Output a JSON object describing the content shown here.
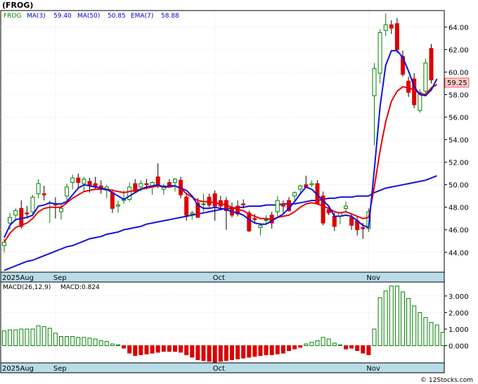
{
  "title": "(FROG)",
  "legend": [
    {
      "text": "FROG",
      "color": "#008000"
    },
    {
      "text": "MA(3)",
      "color": "#0000cc"
    },
    {
      "text": "59.40",
      "color": "#0000cc"
    },
    {
      "text": "MA(50)",
      "color": "#0000cc"
    },
    {
      "text": "50.85",
      "color": "#0000cc"
    },
    {
      "text": "EMA(7)",
      "color": "#0000cc"
    },
    {
      "text": "58.88",
      "color": "#0000cc"
    }
  ],
  "last_price": "59.25",
  "macd_legend": {
    "label": "MACD(26,12,9)",
    "value_label": "MACD:0.824"
  },
  "watermark": "© 12Stocks.com",
  "colors": {
    "up": "#008000",
    "down": "#dd0000",
    "ma": "#1111dd",
    "ema": "#ee0000",
    "axis_band": "#b8dde8",
    "grid": "#cccccc"
  },
  "chart_data": [
    {
      "type": "candlestick",
      "title": "(FROG)",
      "x_labels": [
        "2025Aug",
        "Sep",
        "Oct",
        "Nov"
      ],
      "x_label_index": [
        0,
        9,
        37,
        64
      ],
      "y_ticks": [
        "44.00",
        "46.00",
        "48.00",
        "50.00",
        "52.00",
        "54.00",
        "56.00",
        "58.00",
        "60.00",
        "62.00",
        "64.00"
      ],
      "ylim": [
        42.3,
        65.4
      ],
      "candles": [
        {
          "o": 44.6,
          "h": 45.2,
          "l": 44.0,
          "c": 44.9
        },
        {
          "o": 46.6,
          "h": 47.5,
          "l": 46.0,
          "c": 47.1
        },
        {
          "o": 47.3,
          "h": 47.9,
          "l": 46.8,
          "c": 47.7
        },
        {
          "o": 47.9,
          "h": 48.6,
          "l": 46.1,
          "c": 46.3
        },
        {
          "o": 47.5,
          "h": 48.1,
          "l": 47.0,
          "c": 47.4
        },
        {
          "o": 47.6,
          "h": 49.1,
          "l": 47.4,
          "c": 48.9
        },
        {
          "o": 49.2,
          "h": 50.5,
          "l": 48.8,
          "c": 50.1
        },
        {
          "o": 49.2,
          "h": 49.9,
          "l": 48.6,
          "c": 49.1
        },
        {
          "o": 48.4,
          "h": 48.6,
          "l": 46.6,
          "c": 48.4
        },
        {
          "o": 48.3,
          "h": 48.9,
          "l": 47.0,
          "c": 48.2
        },
        {
          "o": 47.6,
          "h": 48.3,
          "l": 46.9,
          "c": 47.9
        },
        {
          "o": 49.0,
          "h": 50.1,
          "l": 48.5,
          "c": 49.8
        },
        {
          "o": 50.2,
          "h": 50.9,
          "l": 49.6,
          "c": 50.6
        },
        {
          "o": 50.6,
          "h": 51.0,
          "l": 49.7,
          "c": 50.2
        },
        {
          "o": 50.1,
          "h": 50.7,
          "l": 49.4,
          "c": 50.5
        },
        {
          "o": 50.3,
          "h": 50.6,
          "l": 49.3,
          "c": 49.9
        },
        {
          "o": 50.1,
          "h": 50.7,
          "l": 49.6,
          "c": 49.8
        },
        {
          "o": 49.9,
          "h": 50.4,
          "l": 49.2,
          "c": 49.6
        },
        {
          "o": 49.5,
          "h": 50.0,
          "l": 48.8,
          "c": 49.8
        },
        {
          "o": 49.3,
          "h": 49.6,
          "l": 47.5,
          "c": 47.9
        },
        {
          "o": 48.1,
          "h": 48.6,
          "l": 47.5,
          "c": 48.2
        },
        {
          "o": 48.6,
          "h": 49.5,
          "l": 48.3,
          "c": 48.7
        },
        {
          "o": 48.7,
          "h": 50.2,
          "l": 48.5,
          "c": 49.8
        },
        {
          "o": 50.1,
          "h": 50.5,
          "l": 49.3,
          "c": 49.4
        },
        {
          "o": 49.8,
          "h": 50.4,
          "l": 49.4,
          "c": 50.1
        },
        {
          "o": 50.1,
          "h": 50.5,
          "l": 49.6,
          "c": 50.0
        },
        {
          "o": 49.9,
          "h": 50.3,
          "l": 49.1,
          "c": 50.2
        },
        {
          "o": 50.7,
          "h": 51.9,
          "l": 49.7,
          "c": 49.9
        },
        {
          "o": 49.6,
          "h": 50.1,
          "l": 49.1,
          "c": 49.9
        },
        {
          "o": 50.2,
          "h": 50.5,
          "l": 49.8,
          "c": 49.9
        },
        {
          "o": 50.2,
          "h": 50.6,
          "l": 49.4,
          "c": 50.5
        },
        {
          "o": 50.4,
          "h": 50.7,
          "l": 48.8,
          "c": 49.1
        },
        {
          "o": 48.9,
          "h": 49.2,
          "l": 46.8,
          "c": 47.3
        },
        {
          "o": 47.4,
          "h": 47.7,
          "l": 46.9,
          "c": 47.5
        },
        {
          "o": 48.4,
          "h": 48.8,
          "l": 47.1,
          "c": 47.1
        },
        {
          "o": 48.3,
          "h": 49.2,
          "l": 47.6,
          "c": 48.3
        },
        {
          "o": 48.9,
          "h": 49.2,
          "l": 48.0,
          "c": 48.2
        },
        {
          "o": 49.2,
          "h": 49.5,
          "l": 46.8,
          "c": 48.1
        },
        {
          "o": 48.6,
          "h": 49.0,
          "l": 47.8,
          "c": 48.1
        },
        {
          "o": 48.6,
          "h": 48.9,
          "l": 46.0,
          "c": 47.7
        },
        {
          "o": 48.0,
          "h": 48.4,
          "l": 47.1,
          "c": 47.3
        },
        {
          "o": 48.1,
          "h": 48.6,
          "l": 47.2,
          "c": 47.4
        },
        {
          "o": 48.3,
          "h": 48.7,
          "l": 47.9,
          "c": 48.2
        },
        {
          "o": 47.5,
          "h": 47.7,
          "l": 45.8,
          "c": 45.9
        },
        {
          "o": 47.0,
          "h": 47.4,
          "l": 46.6,
          "c": 46.9
        },
        {
          "o": 46.2,
          "h": 46.6,
          "l": 45.5,
          "c": 46.4
        },
        {
          "o": 46.9,
          "h": 47.3,
          "l": 46.5,
          "c": 46.9
        },
        {
          "o": 47.3,
          "h": 47.6,
          "l": 46.1,
          "c": 46.6
        },
        {
          "o": 47.6,
          "h": 49.0,
          "l": 47.2,
          "c": 48.6
        },
        {
          "o": 48.3,
          "h": 48.6,
          "l": 47.5,
          "c": 48.1
        },
        {
          "o": 48.6,
          "h": 48.9,
          "l": 47.6,
          "c": 47.7
        },
        {
          "o": 49.0,
          "h": 49.4,
          "l": 48.6,
          "c": 49.3
        },
        {
          "o": 49.6,
          "h": 50.0,
          "l": 49.3,
          "c": 49.9
        },
        {
          "o": 50.0,
          "h": 50.8,
          "l": 49.8,
          "c": 49.8
        },
        {
          "o": 50.0,
          "h": 50.4,
          "l": 49.8,
          "c": 50.1
        },
        {
          "o": 50.1,
          "h": 50.4,
          "l": 48.3,
          "c": 48.3
        },
        {
          "o": 49.0,
          "h": 49.4,
          "l": 46.4,
          "c": 46.6
        },
        {
          "o": 47.8,
          "h": 48.1,
          "l": 47.3,
          "c": 47.5
        },
        {
          "o": 47.2,
          "h": 47.5,
          "l": 45.9,
          "c": 46.3
        },
        {
          "o": 47.2,
          "h": 47.6,
          "l": 46.5,
          "c": 47.5
        },
        {
          "o": 47.9,
          "h": 48.5,
          "l": 47.6,
          "c": 48.1
        },
        {
          "o": 47.1,
          "h": 47.4,
          "l": 46.0,
          "c": 46.4
        },
        {
          "o": 46.8,
          "h": 47.2,
          "l": 45.5,
          "c": 46.0
        },
        {
          "o": 46.2,
          "h": 46.6,
          "l": 45.2,
          "c": 46.1
        },
        {
          "o": 46.1,
          "h": 47.9,
          "l": 45.8,
          "c": 47.6
        },
        {
          "o": 57.9,
          "h": 60.8,
          "l": 53.5,
          "c": 60.3
        },
        {
          "o": 59.9,
          "h": 63.8,
          "l": 59.0,
          "c": 63.5
        },
        {
          "o": 63.7,
          "h": 65.2,
          "l": 63.2,
          "c": 64.2
        },
        {
          "o": 64.2,
          "h": 64.6,
          "l": 63.4,
          "c": 63.9
        },
        {
          "o": 64.3,
          "h": 64.8,
          "l": 61.7,
          "c": 62.0
        },
        {
          "o": 61.4,
          "h": 61.9,
          "l": 59.6,
          "c": 59.8
        },
        {
          "o": 59.2,
          "h": 59.6,
          "l": 57.8,
          "c": 58.2
        },
        {
          "o": 59.4,
          "h": 59.9,
          "l": 56.8,
          "c": 57.1
        },
        {
          "o": 56.6,
          "h": 58.5,
          "l": 56.4,
          "c": 58.2
        },
        {
          "o": 58.3,
          "h": 61.2,
          "l": 58.0,
          "c": 60.8
        },
        {
          "o": 62.1,
          "h": 62.5,
          "l": 59.0,
          "c": 59.3
        }
      ],
      "ma3": [
        45.3,
        46.4,
        46.9,
        47.0,
        47.1,
        47.3,
        48.1,
        48.2,
        48.4,
        48.3,
        48.3,
        48.5,
        49.1,
        49.7,
        50.0,
        49.9,
        49.8,
        49.7,
        49.6,
        49.3,
        49.0,
        48.7,
        49.0,
        49.3,
        49.6,
        49.8,
        49.9,
        50.0,
        49.8,
        49.9,
        49.9,
        49.7,
        49.5,
        49.0,
        48.2,
        47.9,
        47.9,
        48.0,
        47.9,
        47.8,
        47.6,
        47.5,
        47.3,
        46.9,
        46.6,
        46.5,
        46.5,
        46.8,
        47.1,
        47.4,
        47.9,
        48.5,
        49.2,
        49.8,
        49.6,
        49.1,
        48.6,
        48.1,
        47.2,
        47.2,
        47.3,
        47.2,
        46.8,
        46.4,
        46.2,
        51.3,
        56.9,
        60.6,
        61.9,
        61.9,
        61.3,
        60.1,
        58.7,
        58.0,
        57.9,
        58.4,
        59.4
      ],
      "ema7": [
        44.9,
        45.7,
        46.2,
        46.4,
        46.6,
        47.0,
        47.6,
        47.9,
        48.0,
        48.0,
        48.0,
        48.4,
        48.8,
        49.1,
        49.4,
        49.5,
        49.6,
        49.6,
        49.6,
        49.5,
        49.4,
        49.3,
        49.4,
        49.5,
        49.6,
        49.7,
        49.8,
        49.9,
        49.8,
        49.8,
        49.9,
        49.7,
        49.2,
        48.9,
        48.6,
        48.5,
        48.5,
        48.4,
        48.3,
        48.2,
        48.0,
        47.8,
        47.7,
        47.4,
        47.2,
        47.0,
        47.0,
        46.9,
        47.1,
        47.2,
        47.3,
        47.6,
        48.0,
        48.3,
        48.4,
        48.3,
        48.1,
        47.9,
        47.6,
        47.5,
        47.6,
        47.4,
        47.2,
        47.0,
        47.1,
        49.8,
        53.0,
        55.6,
        57.4,
        58.3,
        58.7,
        58.6,
        58.4,
        58.1,
        58.0,
        58.6,
        58.9
      ],
      "ma50": [
        42.4,
        42.6,
        42.8,
        43.0,
        43.2,
        43.3,
        43.5,
        43.7,
        43.9,
        44.1,
        44.3,
        44.5,
        44.6,
        44.8,
        45.0,
        45.2,
        45.3,
        45.4,
        45.6,
        45.7,
        45.8,
        46.0,
        46.1,
        46.2,
        46.3,
        46.5,
        46.6,
        46.7,
        46.8,
        46.9,
        47.0,
        47.1,
        47.2,
        47.3,
        47.4,
        47.5,
        47.6,
        47.7,
        47.8,
        47.9,
        47.9,
        48.0,
        48.0,
        48.1,
        48.1,
        48.1,
        48.2,
        48.2,
        48.2,
        48.3,
        48.3,
        48.3,
        48.4,
        48.5,
        48.6,
        48.6,
        48.7,
        48.8,
        48.8,
        48.9,
        48.9,
        48.9,
        49.0,
        49.0,
        49.0,
        49.3,
        49.5,
        49.7,
        49.8,
        49.9,
        50.0,
        50.1,
        50.2,
        50.3,
        50.4,
        50.6,
        50.8
      ]
    },
    {
      "type": "bar",
      "title": "MACD(26,12,9)",
      "label": "MACD:0.824",
      "y_ticks": [
        "0.000",
        "1.000",
        "2.000",
        "3.000"
      ],
      "ylim": [
        -1.0,
        3.8
      ],
      "x_labels": [
        "2025Aug",
        "Sep",
        "Oct",
        "Nov"
      ],
      "x_label_index": [
        0,
        9,
        37,
        64
      ],
      "values": [
        0.9,
        0.95,
        0.95,
        1.0,
        1.0,
        1.0,
        1.2,
        1.15,
        1.05,
        0.75,
        0.55,
        0.55,
        0.55,
        0.5,
        0.5,
        0.45,
        0.4,
        0.3,
        0.25,
        0.1,
        0.05,
        -0.15,
        -0.45,
        -0.6,
        -0.55,
        -0.5,
        -0.45,
        -0.4,
        -0.35,
        -0.35,
        -0.35,
        -0.4,
        -0.55,
        -0.7,
        -0.85,
        -0.9,
        -0.95,
        -1.0,
        -0.95,
        -0.9,
        -0.85,
        -0.8,
        -0.75,
        -0.7,
        -0.65,
        -0.6,
        -0.55,
        -0.55,
        -0.5,
        -0.45,
        -0.3,
        -0.2,
        -0.1,
        0.1,
        0.2,
        0.3,
        0.5,
        0.4,
        0.15,
        0.05,
        -0.2,
        -0.15,
        -0.3,
        -0.45,
        -0.55,
        1.0,
        2.9,
        3.3,
        3.6,
        3.6,
        3.25,
        2.85,
        2.4,
        2.0,
        1.7,
        1.4,
        1.25,
        0.8
      ]
    }
  ]
}
